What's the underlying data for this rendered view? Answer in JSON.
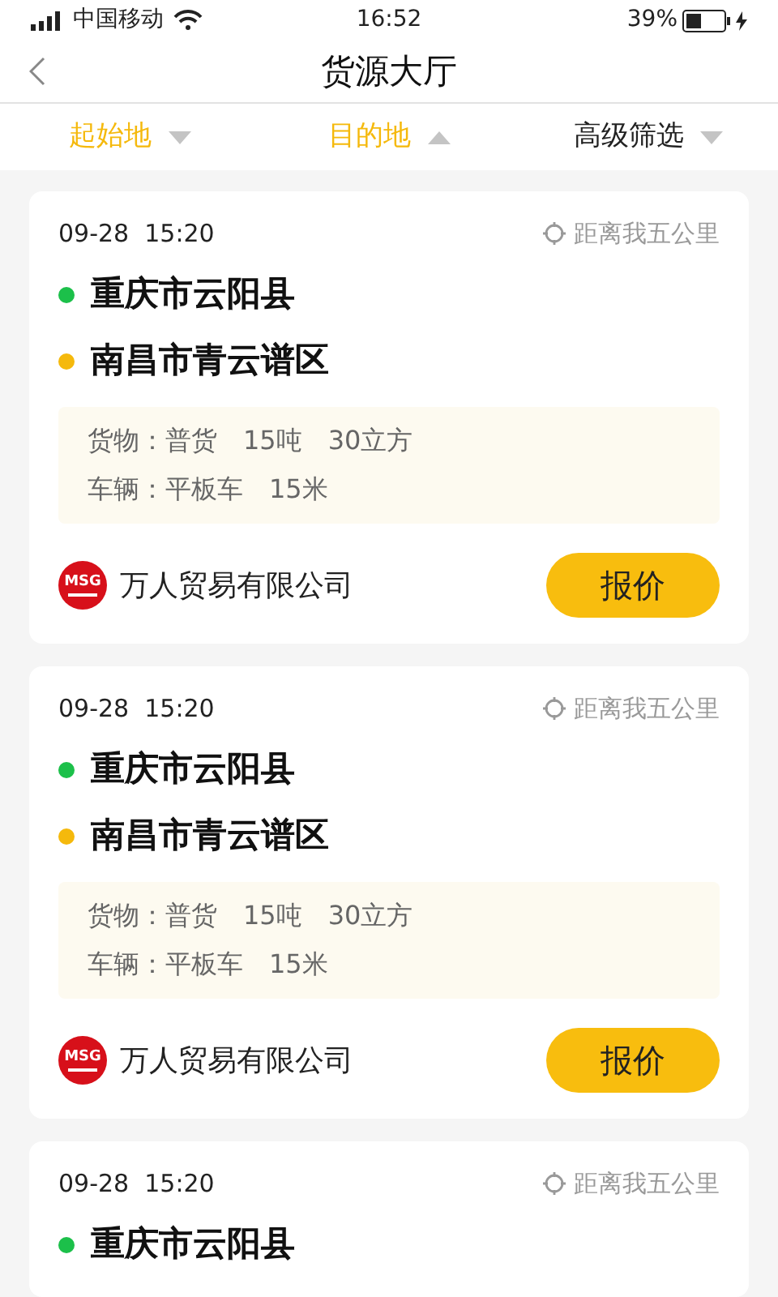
{
  "status_bar": {
    "carrier": "中国移动",
    "time": "16:52",
    "battery": "39%",
    "charging": true
  },
  "nav": {
    "title": "货源大厅"
  },
  "filters": [
    {
      "label": "起始地",
      "active": true,
      "expanded": false
    },
    {
      "label": "目的地",
      "active": true,
      "expanded": true
    },
    {
      "label": "高级筛选",
      "active": false,
      "expanded": false
    }
  ],
  "cards": [
    {
      "datetime": "09-28  15:20",
      "distance": "距离我五公里",
      "origin": "重庆市云阳县",
      "destination": "南昌市青云谱区",
      "cargo": "货物：普货　15吨　30立方",
      "vehicle": "车辆：平板车　15米",
      "company": "万人贸易有限公司",
      "logo_text": "MSG",
      "action": "报价"
    },
    {
      "datetime": "09-28  15:20",
      "distance": "距离我五公里",
      "origin": "重庆市云阳县",
      "destination": "南昌市青云谱区",
      "cargo": "货物：普货　15吨　30立方",
      "vehicle": "车辆：平板车　15米",
      "company": "万人贸易有限公司",
      "logo_text": "MSG",
      "action": "报价"
    },
    {
      "datetime": "09-28  15:20",
      "distance": "距离我五公里",
      "origin": "重庆市云阳县"
    }
  ]
}
